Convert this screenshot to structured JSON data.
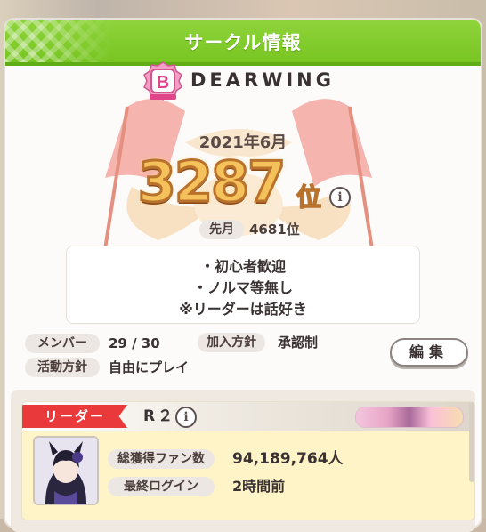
{
  "window": {
    "title": "サークル情報"
  },
  "circle": {
    "rank_badge_letter": "B",
    "name": "DEARWING",
    "month": "2021年6月",
    "rank": "3287",
    "rank_suffix": "位",
    "last_month_label": "先月",
    "last_month_value": "4681位",
    "description": [
      "・初心者歓迎",
      "・ノルマ等無し",
      "※リーダーは話好き"
    ],
    "member_label": "メンバー",
    "member_value": "29 / 30",
    "join_policy_label": "加入方針",
    "join_policy_value": "承認制",
    "activity_label": "活動方針",
    "activity_value": "自由にプレイ",
    "edit_button": "編集"
  },
  "leader": {
    "tag": "リーダー",
    "name": "R２",
    "fans_label": "総獲得ファン数",
    "fans_value": "94,189,764人",
    "last_login_label": "最終ログイン",
    "last_login_value": "2時間前"
  },
  "colors": {
    "header_green": "#7ec826",
    "leader_red": "#e9393b",
    "rank_gold": "#f5c15a",
    "badge_pink": "#e85a9a"
  },
  "icons": {
    "rank_info": "info-icon",
    "leader_info": "info-icon",
    "rank_badge": "b-rank-badge-icon"
  }
}
